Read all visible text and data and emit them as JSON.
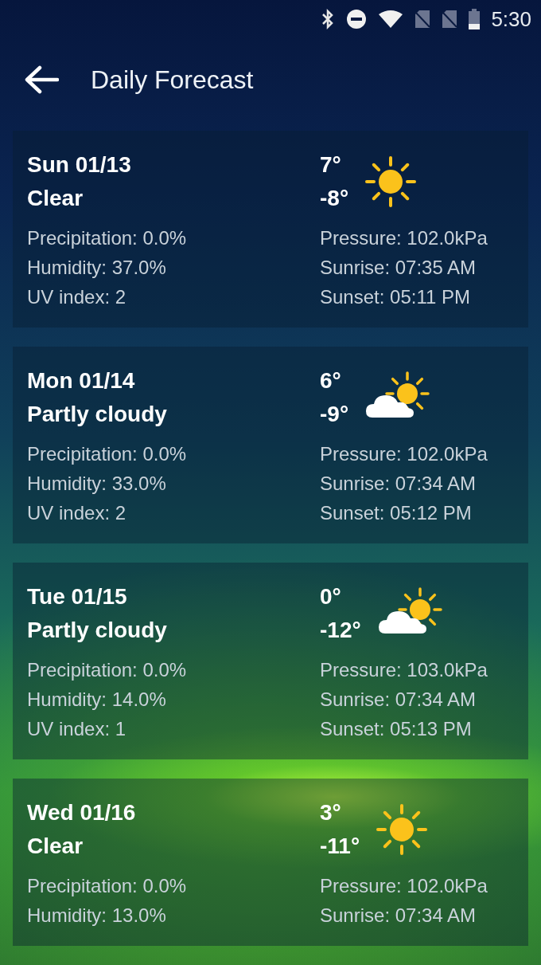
{
  "status_bar": {
    "time": "5:30"
  },
  "header": {
    "title": "Daily Forecast"
  },
  "days": [
    {
      "date": "Sun 01/13",
      "condition": "Clear",
      "high": "7°",
      "low": "-8°",
      "kind": "sun",
      "left": [
        "Precipitation: 0.0%",
        "Humidity: 37.0%",
        "UV index: 2"
      ],
      "right": [
        "Pressure: 102.0kPa",
        "Sunrise: 07:35 AM",
        "Sunset: 05:11 PM"
      ]
    },
    {
      "date": "Mon 01/14",
      "condition": "Partly cloudy",
      "high": "6°",
      "low": "-9°",
      "kind": "partly-cloudy",
      "left": [
        "Precipitation: 0.0%",
        "Humidity: 33.0%",
        "UV index: 2"
      ],
      "right": [
        "Pressure: 102.0kPa",
        "Sunrise: 07:34 AM",
        "Sunset: 05:12 PM"
      ]
    },
    {
      "date": "Tue 01/15",
      "condition": "Partly cloudy",
      "high": "0°",
      "low": "-12°",
      "kind": "partly-cloudy",
      "left": [
        "Precipitation: 0.0%",
        "Humidity: 14.0%",
        "UV index: 1"
      ],
      "right": [
        "Pressure: 103.0kPa",
        "Sunrise: 07:34 AM",
        "Sunset: 05:13 PM"
      ]
    },
    {
      "date": "Wed 01/16",
      "condition": "Clear",
      "high": "3°",
      "low": "-11°",
      "kind": "sun",
      "left": [
        "Precipitation: 0.0%",
        "Humidity: 13.0%"
      ],
      "right": [
        "Pressure: 102.0kPa",
        "Sunrise: 07:34 AM"
      ]
    }
  ]
}
